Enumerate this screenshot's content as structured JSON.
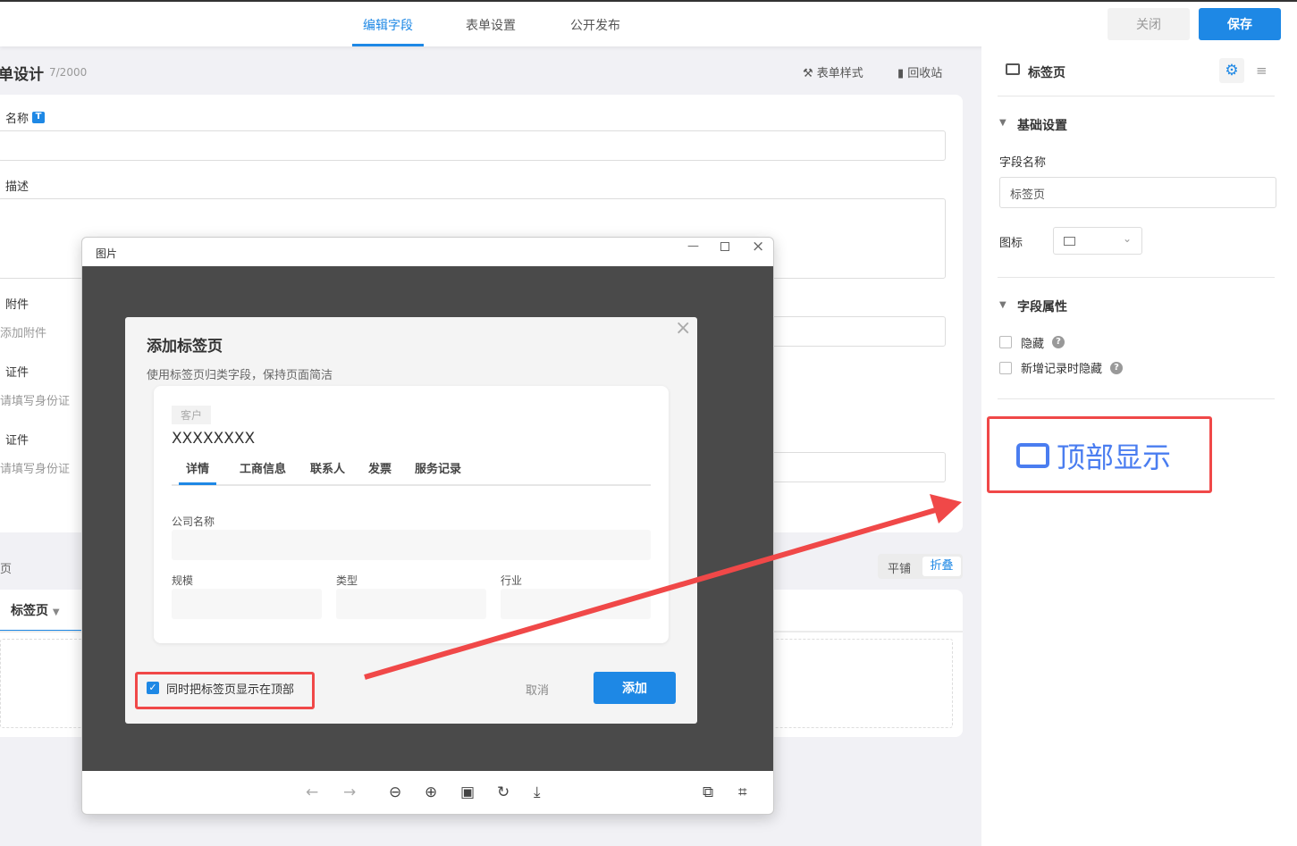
{
  "topbar": {
    "tabs": [
      {
        "label": "编辑字段",
        "active": true
      },
      {
        "label": "表单设置"
      },
      {
        "label": "公开发布"
      }
    ],
    "close": "关闭",
    "save": "保存"
  },
  "form": {
    "title": "单设计",
    "count": "7/2000",
    "style_btn": "表单样式",
    "recycle_btn": "回收站",
    "fields": {
      "name": "名称",
      "name_badge": "T",
      "desc": "描述",
      "attach": "附件",
      "attach_add": "添加附件",
      "id1": "证件",
      "id1_ph": "请填写身份证",
      "id2": "证件",
      "id2_ph": "请填写身份证"
    },
    "section_label": "页",
    "toggle": {
      "tile": "平铺",
      "fold": "折叠",
      "active": "折叠"
    },
    "tab_field": "标签页"
  },
  "viewer": {
    "title": "图片",
    "toolbar": [
      "arrow-left-icon",
      "arrow-right-icon",
      "zoom-out-icon",
      "zoom-in-icon",
      "fit-icon",
      "rotate-icon",
      "download-icon",
      "translate-icon",
      "scan-icon"
    ]
  },
  "dialog": {
    "title": "添加标签页",
    "subtitle": "使用标签页归类字段，保持页面简洁",
    "preview": {
      "tag": "客户",
      "name": "XXXXXXXX",
      "tabs": [
        "详情",
        "工商信息",
        "联系人",
        "发票",
        "服务记录"
      ],
      "company": "公司名称",
      "scale": "规模",
      "type": "类型",
      "industry": "行业"
    },
    "checkbox": {
      "label": "同时把标签页显示在顶部",
      "checked": true
    },
    "cancel": "取消",
    "add": "添加"
  },
  "panel": {
    "title": "标签页",
    "basic": "基础设置",
    "field_name_label": "字段名称",
    "field_name_value": "标签页",
    "icon_label": "图标",
    "attrs": "字段属性",
    "hide": "隐藏",
    "hide_new": "新增记录时隐藏",
    "callout": "顶部显示"
  },
  "colors": {
    "accent": "#1e88e5",
    "annotation": "#f04848"
  }
}
